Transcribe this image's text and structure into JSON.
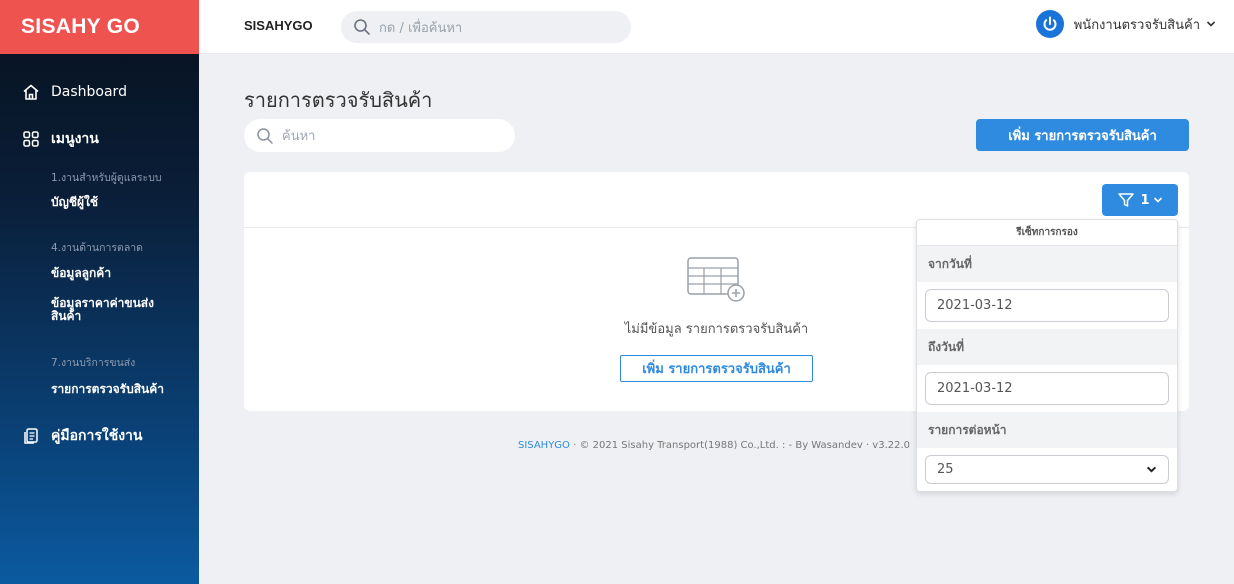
{
  "sidebar": {
    "brand": "SISAHY GO",
    "dashboard": "Dashboard",
    "menu_label": "เมนูงาน",
    "sections": [
      {
        "title": "1.งานสำหรับผู้ดูแลระบบ",
        "items": [
          "บัญชีผู้ใช้"
        ]
      },
      {
        "title": "4.งานด้านการตลาด",
        "items": [
          "ข้อมูลลูกค้า",
          "ข้อมูลราคาค่าขนส่ง สินค้า"
        ]
      },
      {
        "title": "7.งานบริการขนส่ง",
        "items": [
          "รายการตรวจรับสินค้า"
        ]
      }
    ],
    "manual": "คู่มือการใช้งาน"
  },
  "topbar": {
    "logo": "SISAHYGO",
    "search_placeholder": "กด / เพื่อค้นหา",
    "user_name": "พนักงานตรวจรับสินค้า"
  },
  "main": {
    "title": "รายการตรวจรับสินค้า",
    "search_placeholder": "ค้นหา",
    "add_button": "เพิ่ม รายการตรวจรับสินค้า",
    "filter_count": "1",
    "empty_text": "ไม่มีข้อมูล รายการตรวจรับสินค้า",
    "empty_add_button": "เพิ่ม รายการตรวจรับสินค้า"
  },
  "filter": {
    "reset_label": "รีเซ็ทการกรอง",
    "from_label": "จากวันที่",
    "from_value": "2021-03-12",
    "to_label": "ถึงวันที่",
    "to_value": "2021-03-12",
    "per_page_label": "รายการต่อหน้า",
    "per_page_value": "25"
  },
  "footer": {
    "brand": "SISAHYGO",
    "text": " · © 2021 Sisahy Transport(1988) Co.,Ltd. : - By Wasandev · v3.22.0"
  },
  "colors": {
    "brand_red": "#ef5350",
    "primary_blue": "#2f8be0",
    "sidebar_dark": "#07101c",
    "sidebar_blue": "#0b5aa0"
  }
}
